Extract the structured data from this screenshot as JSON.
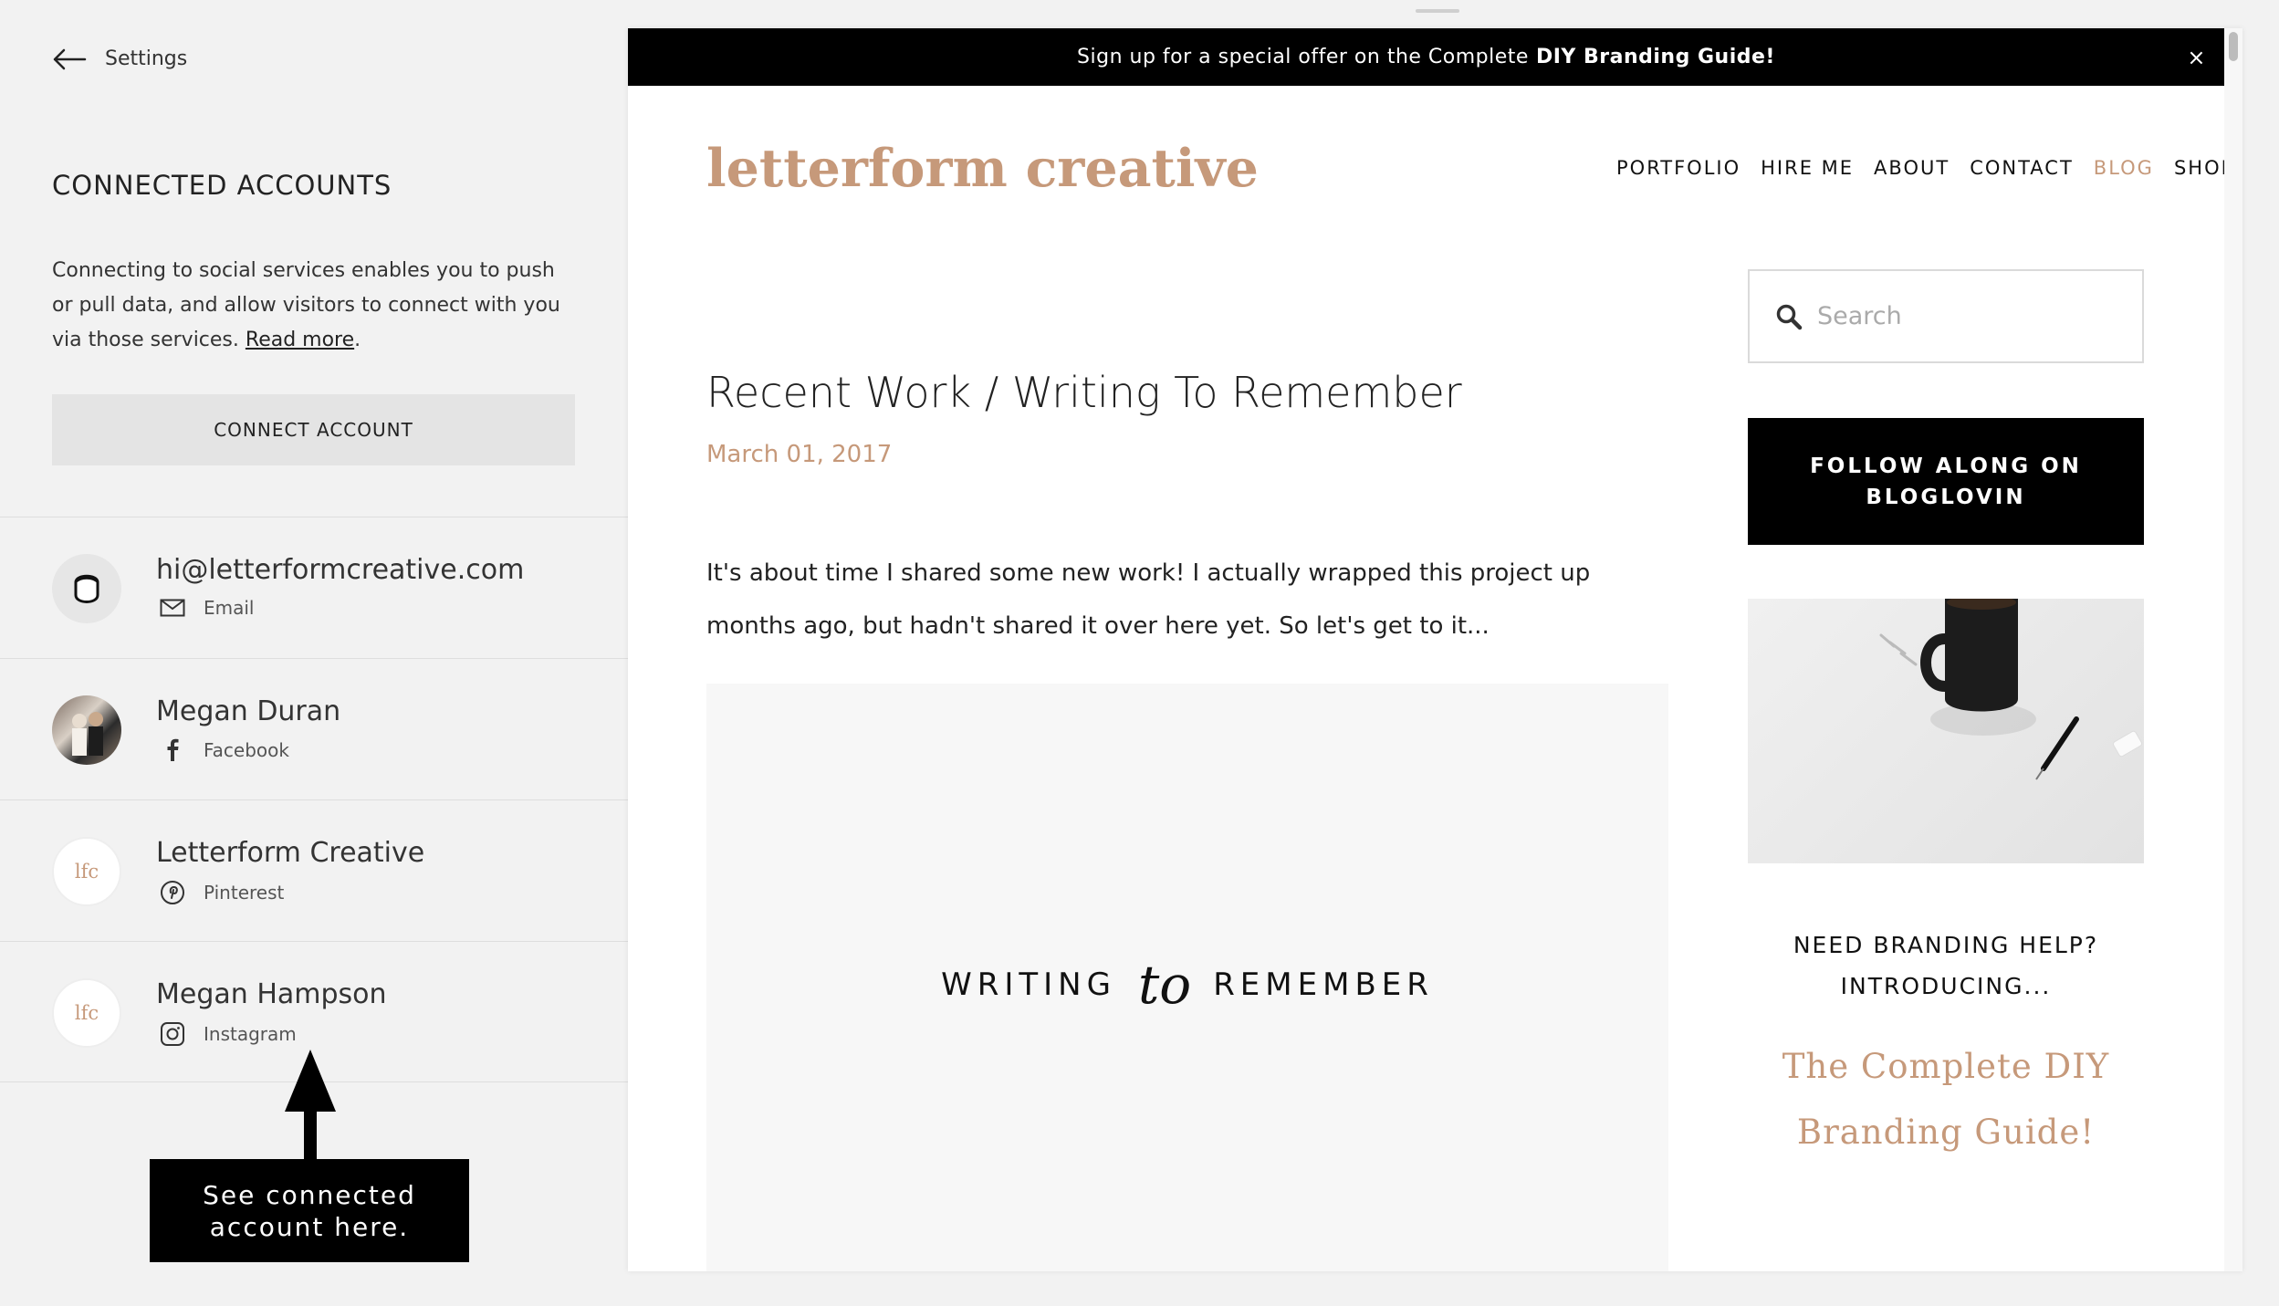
{
  "settings_panel": {
    "back_label": "Settings",
    "title": "CONNECTED ACCOUNTS",
    "description": "Connecting to social services enables you to push or pull data, and allow visitors to connect with you via those services. ",
    "read_more": "Read more",
    "description_end": ".",
    "connect_button": "CONNECT ACCOUNT",
    "accounts": [
      {
        "name": "hi@letterformcreative.com",
        "service": "Email",
        "icon": "mail-icon"
      },
      {
        "name": "Megan Duran",
        "service": "Facebook",
        "icon": "facebook-icon"
      },
      {
        "name": "Letterform Creative",
        "service": "Pinterest",
        "icon": "pinterest-icon",
        "logo_text": "lfc"
      },
      {
        "name": "Megan Hampson",
        "service": "Instagram",
        "icon": "instagram-icon",
        "logo_text": "lfc"
      }
    ]
  },
  "annotation": {
    "text": "See connected\naccount here."
  },
  "preview": {
    "promo_text": "Sign up for a special offer on the Complete",
    "promo_bold": "DIY Branding Guide!",
    "promo_close": "×",
    "site_logo": "letterform creative",
    "nav": [
      "PORTFOLIO",
      "HIRE ME",
      "ABOUT",
      "CONTACT",
      "BLOG",
      "SHOP"
    ],
    "active_nav": "BLOG",
    "post": {
      "title": "Recent Work / Writing To Remember",
      "date": "March 01, 2017",
      "body": "It's about time I shared some new work! I actually wrapped this project up months ago, but hadn't shared it over here yet. So let's get to it...",
      "image_words": [
        "WRITING",
        "to",
        "REMEMBER"
      ]
    },
    "sidebar": {
      "search_placeholder": "Search",
      "follow_button": "FOLLOW ALONG ON\nBLOGLOVIN",
      "need_help": "NEED BRANDING HELP?\nINTRODUCING...",
      "guide_title": "The Complete DIY\nBranding Guide!"
    }
  },
  "colors": {
    "accent": "#c6997a",
    "panel_bg": "#f2f2f2",
    "button_bg": "#e4e4e4",
    "black": "#000000"
  }
}
